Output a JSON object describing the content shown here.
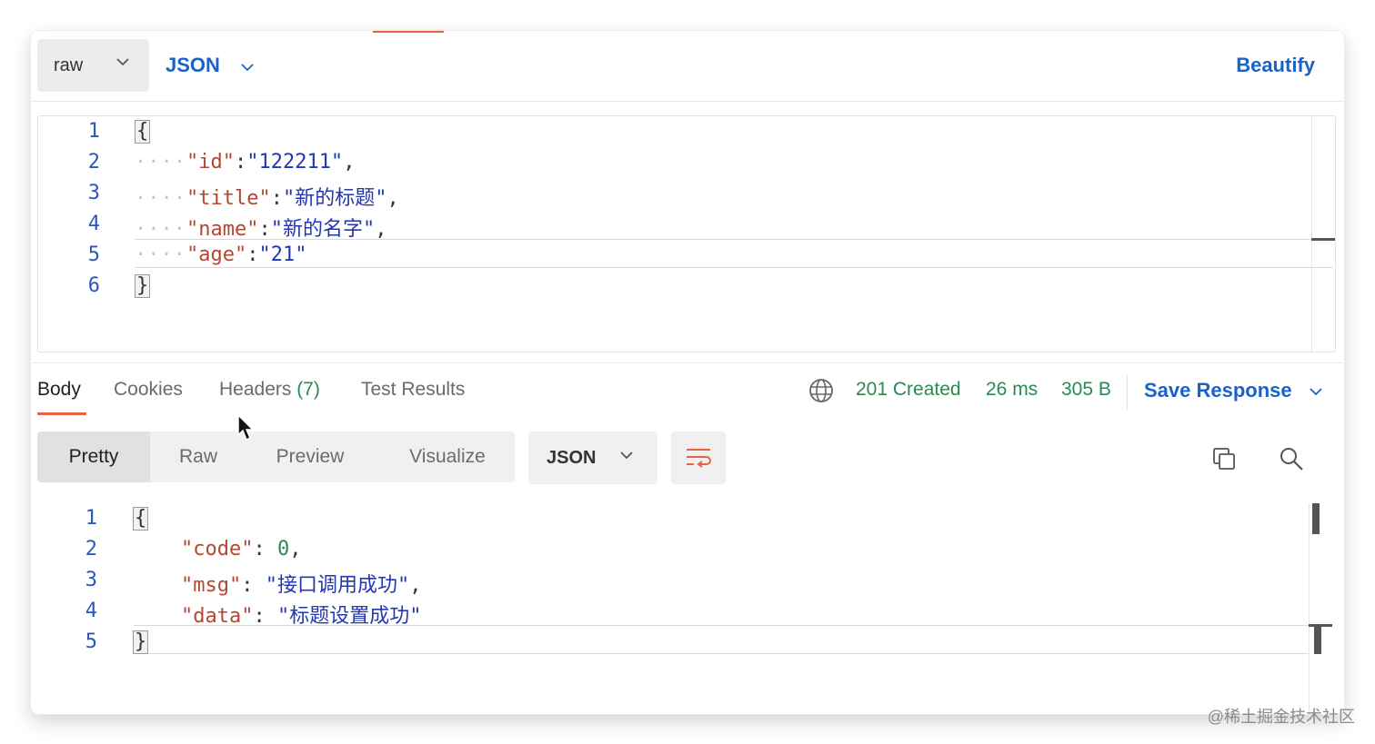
{
  "request": {
    "body_type": "raw",
    "format": "JSON",
    "beautify_label": "Beautify",
    "line_numbers": [
      "1",
      "2",
      "3",
      "4",
      "5",
      "6"
    ],
    "lines": [
      {
        "key": "",
        "value": ""
      },
      {
        "key": "\"id\"",
        "sep": ":",
        "value": "\"122211\"",
        "trail": ","
      },
      {
        "key": "\"title\"",
        "sep": ":",
        "value": "\"新的标题\"",
        "trail": ","
      },
      {
        "key": "\"name\"",
        "sep": ":",
        "value": "\"新的名字\"",
        "trail": ","
      },
      {
        "key": "\"age\"",
        "sep": ":",
        "value": "\"21\"",
        "trail": ""
      }
    ],
    "open_brace": "{",
    "close_brace": "}"
  },
  "response": {
    "tabs": [
      {
        "label": "Body"
      },
      {
        "label": "Cookies"
      },
      {
        "label": "Headers",
        "count": "(7)"
      },
      {
        "label": "Test Results"
      }
    ],
    "status": "201 Created",
    "time": "26 ms",
    "size": "305 B",
    "save_label": "Save Response",
    "views": [
      "Pretty",
      "Raw",
      "Preview",
      "Visualize"
    ],
    "format": "JSON",
    "line_numbers": [
      "1",
      "2",
      "3",
      "4",
      "5"
    ],
    "lines": [
      {
        "key": "\"code\"",
        "sep": ": ",
        "value": "0",
        "trail": ","
      },
      {
        "key": "\"msg\"",
        "sep": ": ",
        "value": "\"接口调用成功\"",
        "trail": ","
      },
      {
        "key": "\"data\"",
        "sep": ": ",
        "value": "\"标题设置成功\"",
        "trail": ""
      }
    ],
    "open_brace": "{",
    "close_brace": "}"
  },
  "watermark": "@稀土掘金技术社区",
  "colors": {
    "accent_orange": "#e8623f",
    "link_blue": "#1a62c9",
    "status_green": "#2b8a52",
    "json_key": "#b34732",
    "json_string": "#2437b3"
  }
}
